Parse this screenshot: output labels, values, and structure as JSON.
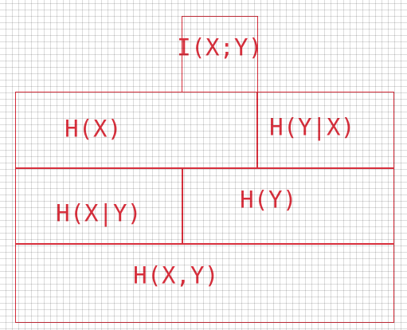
{
  "canvas": {
    "stroke_color": "#d72f3c",
    "grid": "dotted"
  },
  "regions": {
    "mutual_information": "I(X;Y)",
    "entropy_x": "H(X)",
    "conditional_y_given_x": "H(Y|X)",
    "conditional_x_given_y": "H(X|Y)",
    "entropy_y": "H(Y)",
    "joint_entropy": "H(X,Y)"
  }
}
